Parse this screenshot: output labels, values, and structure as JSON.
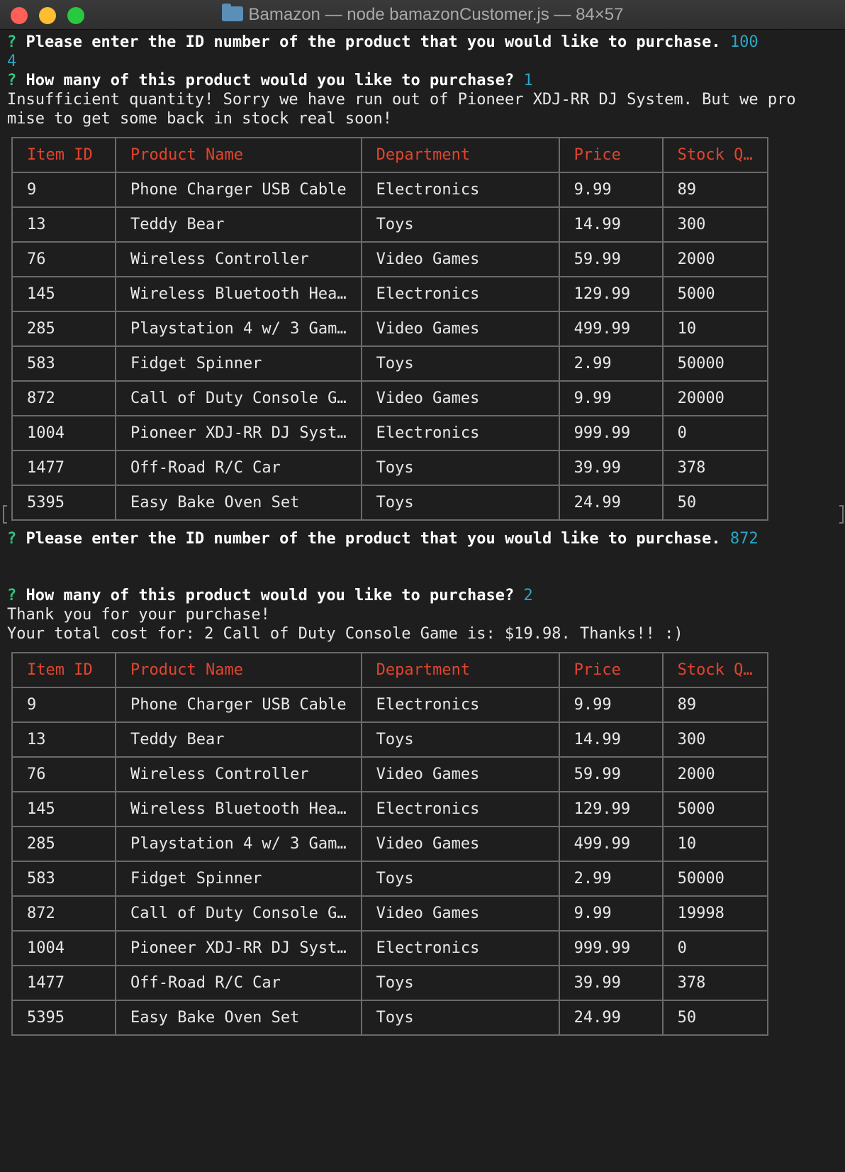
{
  "window": {
    "title": "Bamazon — node bamazonCustomer.js — 84×57"
  },
  "session": {
    "prompt_marker": "?",
    "id_question": "Please enter the ID number of the product that you would like to purchase.",
    "qty_question": "How many of this product would you like to purchase?",
    "first": {
      "id_answer_a": "100",
      "id_answer_b": "4",
      "qty_answer": "1",
      "message_1": "Insufficient quantity! Sorry we have run out of Pioneer XDJ-RR DJ System. But we pro",
      "message_2": "mise to get some back in stock real soon!"
    },
    "second": {
      "id_answer": "872",
      "qty_answer": "2",
      "message_1": "Thank you for your purchase!",
      "message_2": "Your total cost for: 2 Call of Duty Console Game is: $19.98. Thanks!! :)"
    }
  },
  "table_headers": [
    "Item ID",
    "Product Name",
    "Department",
    "Price",
    "Stock Q…"
  ],
  "table1": [
    [
      "9",
      "Phone Charger USB Cable",
      "Electronics",
      "9.99",
      "89"
    ],
    [
      "13",
      "Teddy Bear",
      "Toys",
      "14.99",
      "300"
    ],
    [
      "76",
      "Wireless Controller",
      "Video Games",
      "59.99",
      "2000"
    ],
    [
      "145",
      "Wireless Bluetooth Hea…",
      "Electronics",
      "129.99",
      "5000"
    ],
    [
      "285",
      "Playstation 4 w/ 3 Gam…",
      "Video Games",
      "499.99",
      "10"
    ],
    [
      "583",
      "Fidget Spinner",
      "Toys",
      "2.99",
      "50000"
    ],
    [
      "872",
      "Call of Duty Console G…",
      "Video Games",
      "9.99",
      "20000"
    ],
    [
      "1004",
      "Pioneer XDJ-RR DJ Syst…",
      "Electronics",
      "999.99",
      "0"
    ],
    [
      "1477",
      "Off-Road R/C Car",
      "Toys",
      "39.99",
      "378"
    ],
    [
      "5395",
      "Easy Bake Oven Set",
      "Toys",
      "24.99",
      "50"
    ]
  ],
  "table2": [
    [
      "9",
      "Phone Charger USB Cable",
      "Electronics",
      "9.99",
      "89"
    ],
    [
      "13",
      "Teddy Bear",
      "Toys",
      "14.99",
      "300"
    ],
    [
      "76",
      "Wireless Controller",
      "Video Games",
      "59.99",
      "2000"
    ],
    [
      "145",
      "Wireless Bluetooth Hea…",
      "Electronics",
      "129.99",
      "5000"
    ],
    [
      "285",
      "Playstation 4 w/ 3 Gam…",
      "Video Games",
      "499.99",
      "10"
    ],
    [
      "583",
      "Fidget Spinner",
      "Toys",
      "2.99",
      "50000"
    ],
    [
      "872",
      "Call of Duty Console G…",
      "Video Games",
      "9.99",
      "19998"
    ],
    [
      "1004",
      "Pioneer XDJ-RR DJ Syst…",
      "Electronics",
      "999.99",
      "0"
    ],
    [
      "1477",
      "Off-Road R/C Car",
      "Toys",
      "39.99",
      "378"
    ],
    [
      "5395",
      "Easy Bake Oven Set",
      "Toys",
      "24.99",
      "50"
    ]
  ],
  "colors": {
    "background": "#1e1e1e",
    "header_text": "#e0452f",
    "answer": "#2aa7c4",
    "prompt": "#2ec27e"
  }
}
